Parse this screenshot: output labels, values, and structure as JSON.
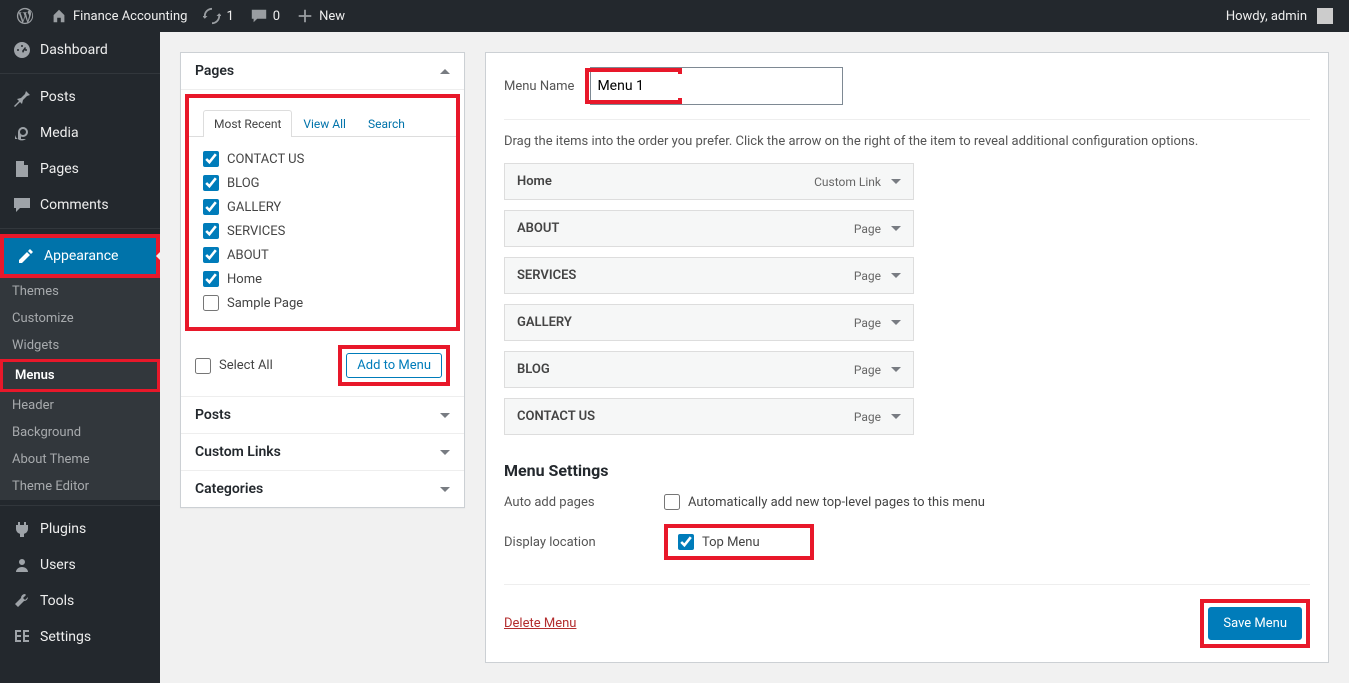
{
  "adminbar": {
    "site_name": "Finance Accounting",
    "updates_count": "1",
    "comments_count": "0",
    "new_label": "New",
    "howdy": "Howdy, admin"
  },
  "sidebar": {
    "dashboard": "Dashboard",
    "posts": "Posts",
    "media": "Media",
    "pages": "Pages",
    "comments": "Comments",
    "appearance": "Appearance",
    "sub_themes": "Themes",
    "sub_customize": "Customize",
    "sub_widgets": "Widgets",
    "sub_menus": "Menus",
    "sub_header": "Header",
    "sub_background": "Background",
    "sub_about_theme": "About Theme",
    "sub_theme_editor": "Theme Editor",
    "plugins": "Plugins",
    "users": "Users",
    "tools": "Tools",
    "settings": "Settings"
  },
  "pages_panel": {
    "title": "Pages",
    "tab_recent": "Most Recent",
    "tab_viewall": "View All",
    "tab_search": "Search",
    "items": [
      {
        "label": "CONTACT US",
        "checked": true
      },
      {
        "label": "BLOG",
        "checked": true
      },
      {
        "label": "GALLERY",
        "checked": true
      },
      {
        "label": "SERVICES",
        "checked": true
      },
      {
        "label": "ABOUT",
        "checked": true
      },
      {
        "label": "Home",
        "checked": true
      },
      {
        "label": "Sample Page",
        "checked": false
      }
    ],
    "select_all": "Select All",
    "add_btn": "Add to Menu"
  },
  "collapsed_panels": [
    "Posts",
    "Custom Links",
    "Categories"
  ],
  "menu_editor": {
    "name_label": "Menu Name",
    "name_value": "Menu 1",
    "desc": "Drag the items into the order you prefer. Click the arrow on the right of the item to reveal additional configuration options.",
    "items": [
      {
        "title": "Home",
        "type": "Custom Link"
      },
      {
        "title": "ABOUT",
        "type": "Page"
      },
      {
        "title": "SERVICES",
        "type": "Page"
      },
      {
        "title": "GALLERY",
        "type": "Page"
      },
      {
        "title": "BLOG",
        "type": "Page"
      },
      {
        "title": "CONTACT US",
        "type": "Page"
      }
    ],
    "settings_title": "Menu Settings",
    "auto_add_label": "Auto add pages",
    "auto_add_text": "Automatically add new top-level pages to this menu",
    "display_loc_label": "Display location",
    "display_loc_text": "Top Menu",
    "delete_link": "Delete Menu",
    "save_btn": "Save Menu"
  }
}
